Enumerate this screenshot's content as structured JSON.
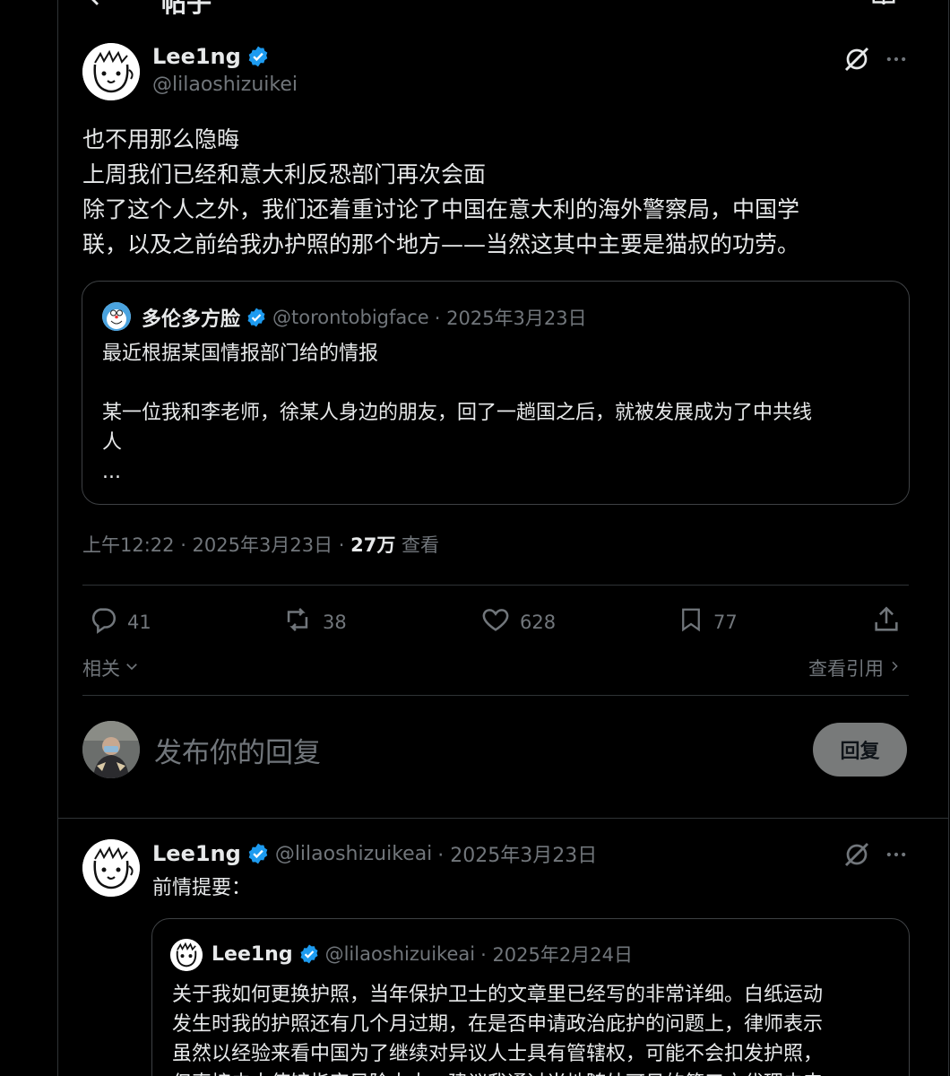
{
  "header": {
    "title": "帖子"
  },
  "main_post": {
    "display_name": "Lee1ng",
    "handle": "@lilaoshizuikei",
    "lines": [
      "也不用那么隐晦",
      "上周我们已经和意大利反恐部门再次会面",
      "除了这个人之外，我们还着重讨论了中国在意大利的海外警察局，中国学",
      "联，以及之前给我办护照的那个地方——当然这其中主要是猫叔的功劳。"
    ],
    "quote": {
      "display_name": "多伦多方脸",
      "handle": "@torontobigface",
      "date": "· 2025年3月23日",
      "lines": [
        "最近根据某国情报部门给的情报",
        "",
        "某一位我和李老师，徐某人身边的朋友，回了一趟国之后，就被发展成为了中共线",
        "人",
        "..."
      ]
    },
    "meta": {
      "time": "上午12:22 · 2025年3月23日 ·",
      "views": "27万",
      "views_label": "查看"
    },
    "stats": {
      "replies": "41",
      "reposts": "38",
      "likes": "628",
      "bookmarks": "77"
    },
    "related_label": "相关",
    "view_quotes_label": "查看引用"
  },
  "composer": {
    "placeholder": "发布你的回复",
    "reply_button": "回复"
  },
  "reply_post": {
    "display_name": "Lee1ng",
    "handle": "@lilaoshizuikeai",
    "date": "· 2025年3月23日",
    "text": "前情提要：",
    "quote": {
      "display_name": "Lee1ng",
      "handle": "@lilaoshizuikeai",
      "date": "· 2025年2月24日",
      "lines": [
        "关于我如何更换护照，当年保护卫士的文章里已经写的非常详细。白纸运动",
        "发生时我的护照还有几个月过期，在是否申请政治庇护的问题上，律师表示",
        "虽然以经验来看中国为了继续对异议人士具有管辖权，可能不会扣发护照，",
        "但直接去大使馆指定风险太大，建议我通过当地随处可见的第三方代理去申"
      ]
    }
  },
  "colors": {
    "background": "#000000",
    "border": "#2f3336",
    "text": "#e7e9ea",
    "muted": "#71767b",
    "verified": "#1d9bf0"
  },
  "icons": [
    "back-arrow-icon",
    "reader-icon",
    "grok-icon",
    "more-icon",
    "verified-badge-icon",
    "reply-icon",
    "repost-icon",
    "like-icon",
    "bookmark-icon",
    "share-icon",
    "chevron-down-icon",
    "chevron-right-icon"
  ]
}
